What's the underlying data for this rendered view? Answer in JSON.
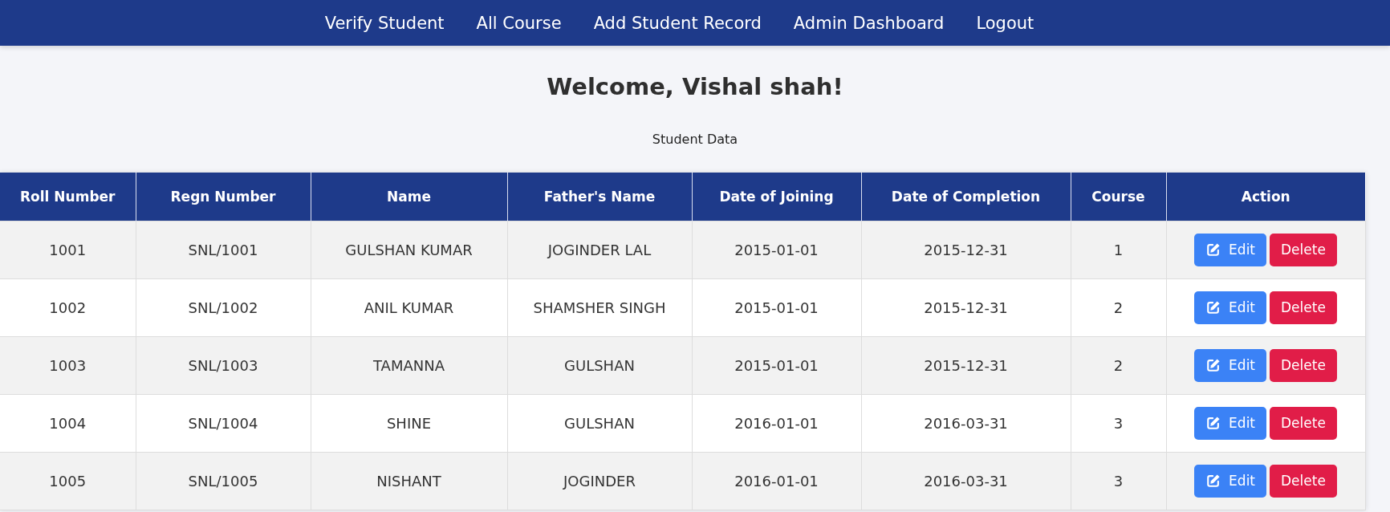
{
  "navbar": {
    "links": [
      {
        "label": "Verify Student"
      },
      {
        "label": "All Course"
      },
      {
        "label": "Add Student Record"
      },
      {
        "label": "Admin Dashboard"
      },
      {
        "label": "Logout"
      }
    ]
  },
  "heading": "Welcome, Vishal shah!",
  "subheading": "Student Data",
  "table": {
    "columns": [
      "Roll Number",
      "Regn Number",
      "Name",
      "Father's Name",
      "Date of Joining",
      "Date of Completion",
      "Course",
      "Action"
    ],
    "rows": [
      {
        "cells": [
          "1001",
          "SNL/1001",
          "GULSHAN KUMAR",
          "JOGINDER LAL",
          "2015-01-01",
          "2015-12-31",
          "1"
        ],
        "actions": [
          {
            "kind": "edit",
            "label": "Edit"
          },
          {
            "kind": "delete",
            "label": "Delete"
          }
        ]
      },
      {
        "cells": [
          "1002",
          "SNL/1002",
          "ANIL KUMAR",
          "SHAMSHER SINGH",
          "2015-01-01",
          "2015-12-31",
          "2"
        ],
        "actions": [
          {
            "kind": "edit",
            "label": "Edit"
          },
          {
            "kind": "delete",
            "label": "Delete"
          }
        ]
      },
      {
        "cells": [
          "1003",
          "SNL/1003",
          "TAMANNA",
          "GULSHAN",
          "2015-01-01",
          "2015-12-31",
          "2"
        ],
        "actions": [
          {
            "kind": "edit",
            "label": "Edit"
          },
          {
            "kind": "delete",
            "label": "Delete"
          }
        ]
      },
      {
        "cells": [
          "1004",
          "SNL/1004",
          "SHINE",
          "GULSHAN",
          "2016-01-01",
          "2016-03-31",
          "3"
        ],
        "actions": [
          {
            "kind": "edit",
            "label": "Edit"
          },
          {
            "kind": "delete",
            "label": "Delete"
          }
        ]
      },
      {
        "cells": [
          "1005",
          "SNL/1005",
          "NISHANT",
          "JOGINDER",
          "2016-01-01",
          "2016-03-31",
          "3"
        ],
        "actions": [
          {
            "kind": "edit",
            "label": "Edit"
          },
          {
            "kind": "delete",
            "label": "Delete"
          }
        ]
      }
    ]
  }
}
